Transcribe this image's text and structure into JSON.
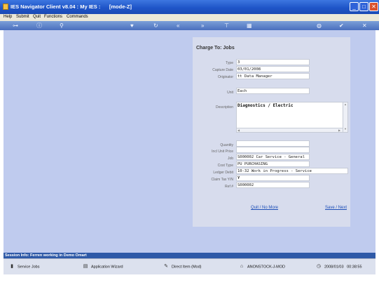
{
  "window": {
    "title": "IES Navigator Client v8.04 : My IES :      [mode-Z]"
  },
  "menu": {
    "items": [
      "Help",
      "Submit",
      "Quit",
      "Functions",
      "Commands"
    ]
  },
  "toolbar": {
    "icons": [
      "key-icon",
      "info-icon",
      "search-icon",
      "heart-icon",
      "refresh-icon",
      "rewind-icon",
      "forward-icon",
      "filter-icon",
      "grid-icon",
      "globe-icon",
      "check-icon",
      "close-icon"
    ]
  },
  "form": {
    "title": "Charge To: Jobs",
    "fields": {
      "type": {
        "label": "Type",
        "value": "3"
      },
      "capture_date": {
        "label": "Capture Date",
        "value": "03/01/2008"
      },
      "originator": {
        "label": "Originator",
        "value": "tt Data Manager"
      },
      "unit": {
        "label": "Unit",
        "value": "Each"
      },
      "description": {
        "label": "Description",
        "value": "Diagnostics / Electric"
      },
      "quantity": {
        "label": "Quantity",
        "value": ""
      },
      "incl_unit_price": {
        "label": "Incl Unit Price",
        "value": ""
      },
      "job": {
        "label": "Job",
        "value": "S000002 Car Service - General"
      },
      "cost_type": {
        "label": "Cost Type",
        "value": "PU PURCHASING"
      },
      "ledger_debit": {
        "label": "Ledger Debit",
        "value": "10-32 Work in Progress - Service"
      },
      "claim_tax": {
        "label": "Claim Tax Y/N",
        "value": "Y"
      },
      "ref": {
        "label": "Ref #",
        "value": "S000002"
      }
    },
    "actions": {
      "quit": "Quit / No More",
      "save": "Save / Next"
    }
  },
  "session": {
    "text": "Session Info: Ferren working in Demo Omart"
  },
  "status": {
    "items": [
      "Service Jobs",
      "Application Wizard",
      "Direct Item (Mod)",
      "ANONSTOCK-J-MOD"
    ],
    "date": "2008/01/03",
    "time": "00:38:55"
  }
}
